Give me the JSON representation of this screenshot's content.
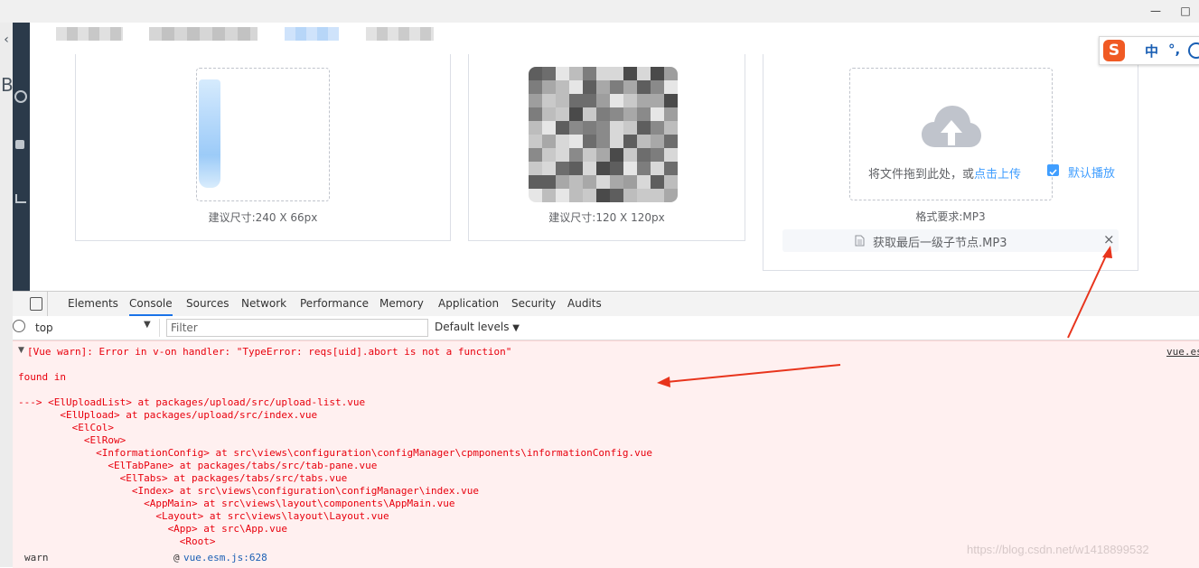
{
  "header": {
    "tabs_blurred": 4
  },
  "cards": {
    "card1_hint": "建议尺寸:240 X 66px",
    "card2_hint": "建议尺寸:120 X 120px",
    "upload": {
      "drag_text": "将文件拖到此处，或",
      "click_text": "点击上传",
      "checkbox_label": "默认播放",
      "format_hint": "格式要求:MP3",
      "file_name": "获取最后一级子节点.MP3"
    }
  },
  "ime": {
    "logo": "S",
    "lang": "中",
    "punct": "°,"
  },
  "devtools": {
    "tabs": [
      "Elements",
      "Console",
      "Sources",
      "Network",
      "Performance",
      "Memory",
      "Application",
      "Security",
      "Audits"
    ],
    "active_tab": "Console",
    "context": "top",
    "filter_placeholder": "Filter",
    "levels": "Default levels",
    "error_header": "[Vue warn]: Error in v-on handler: \"TypeError: reqs[uid].abort is not a function\"",
    "source_link": "vue.es",
    "found_in": "found in",
    "trace": [
      "---> <ElUploadList> at packages/upload/src/upload-list.vue",
      "       <ElUpload> at packages/upload/src/index.vue",
      "         <ElCol>",
      "           <ElRow>",
      "             <InformationConfig> at src\\views\\configuration\\configManager\\cpmponents\\informationConfig.vue",
      "               <ElTabPane> at packages/tabs/src/tab-pane.vue",
      "                 <ElTabs> at packages/tabs/src/tabs.vue",
      "                   <Index> at src\\views\\configuration\\configManager\\index.vue",
      "                     <AppMain> at src\\views\\layout\\components\\AppMain.vue",
      "                       <Layout> at src\\views\\layout\\Layout.vue",
      "                         <App> at src\\App.vue",
      "                           <Root>"
    ],
    "warn_label": "warn",
    "warn_at": "@",
    "warn_link": "vue.esm.js:628",
    "watermark": "https://blog.csdn.net/w1418899532"
  },
  "colors": {
    "accent": "#409eff",
    "error": "#e8000d",
    "arrow": "#e8341c"
  }
}
